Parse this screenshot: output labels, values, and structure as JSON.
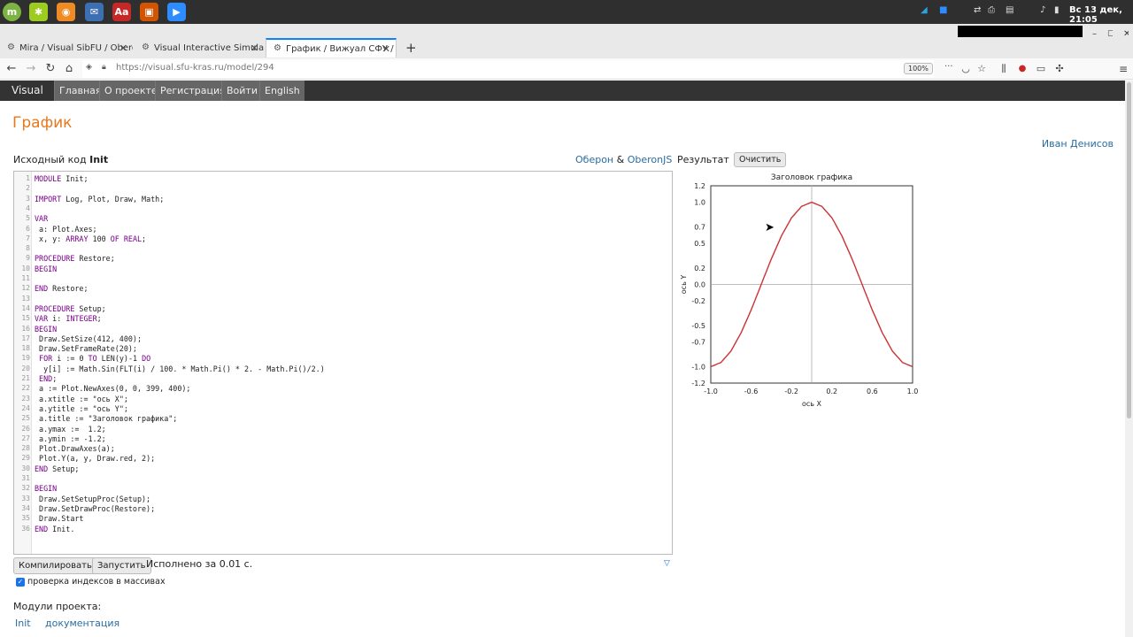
{
  "browser": {
    "tabs": [
      {
        "label": "Mira / Visual SibFU / Oberon",
        "active": false
      },
      {
        "label": "Visual Interactive Simulation",
        "active": false
      },
      {
        "label": "График / Вижуал СФУ / Об",
        "active": true
      }
    ],
    "url": "https://visual.sfu-kras.ru/model/294",
    "zoom": "100%",
    "datetime": "Вс 13 дек, 21:05"
  },
  "sitenav": {
    "brand": "Visual",
    "items": [
      "Главная",
      "О проекте",
      "Регистрация",
      "Войти",
      "English"
    ]
  },
  "page": {
    "title": "График",
    "user": "Иван Денисов",
    "source_label_prefix": "Исходный код ",
    "source_module": "Init",
    "links": [
      "Оберон",
      "&",
      "OberonJS"
    ],
    "result_label": "Результат",
    "clear_button": "Очистить",
    "compile_button": "Компилировать",
    "run_button": "Запустить",
    "exec_status": "Исполнено за 0.01 с.",
    "check_label": "проверка индексов в массивах",
    "modules_label": "Модули проекта:",
    "module_links": [
      "Init",
      "документация"
    ]
  },
  "code": [
    "MODULE Init;",
    "",
    "IMPORT Log, Plot, Draw, Math;",
    "",
    "VAR",
    " a: Plot.Axes;",
    " x, y: ARRAY 100 OF REAL;",
    "",
    "PROCEDURE Restore;",
    "BEGIN",
    "",
    "END Restore;",
    "",
    "PROCEDURE Setup;",
    "VAR i: INTEGER;",
    "BEGIN",
    " Draw.SetSize(412, 400);",
    " Draw.SetFrameRate(20);",
    " FOR i := 0 TO LEN(y)-1 DO",
    "  y[i] := Math.Sin(FLT(i) / 100. * Math.Pi() * 2. - Math.Pi()/2.)",
    " END;",
    " a := Plot.NewAxes(0, 0, 399, 400);",
    " a.xtitle := \"ось X\";",
    " a.ytitle := \"ось Y\";",
    " a.title := \"Заголовок графика\";",
    " a.ymax :=  1.2;",
    " a.ymin := -1.2;",
    " Plot.DrawAxes(a);",
    " Plot.Y(a, y, Draw.red, 2);",
    "END Setup;",
    "",
    "BEGIN",
    " Draw.SetSetupProc(Setup);",
    " Draw.SetDrawProc(Restore);",
    " Draw.Start",
    "END Init."
  ],
  "chart_data": {
    "type": "line",
    "title": "Заголовок графика",
    "xlabel": "ось X",
    "ylabel": "ось Y",
    "xlim": [
      -1.0,
      1.0
    ],
    "ylim": [
      -1.2,
      1.2
    ],
    "xticks": [
      "-1.0",
      "-0.6",
      "-0.2",
      "0.2",
      "0.6",
      "1.0"
    ],
    "yticks": [
      "1.2",
      "1.0",
      "0.7",
      "0.5",
      "0.2",
      "0.0",
      "-0.2",
      "-0.5",
      "-0.7",
      "-1.0",
      "-1.2"
    ],
    "series": [
      {
        "color": "#cc3333",
        "x": [
          -1.0,
          -0.9,
          -0.8,
          -0.7,
          -0.6,
          -0.5,
          -0.4,
          -0.3,
          -0.2,
          -0.1,
          0.0,
          0.1,
          0.2,
          0.3,
          0.4,
          0.5,
          0.6,
          0.7,
          0.8,
          0.9,
          1.0
        ],
        "y": [
          -1.0,
          -0.95,
          -0.81,
          -0.59,
          -0.31,
          0.0,
          0.31,
          0.59,
          0.81,
          0.95,
          1.0,
          0.95,
          0.81,
          0.59,
          0.31,
          0.0,
          -0.31,
          -0.59,
          -0.81,
          -0.95,
          -1.0
        ]
      }
    ]
  }
}
